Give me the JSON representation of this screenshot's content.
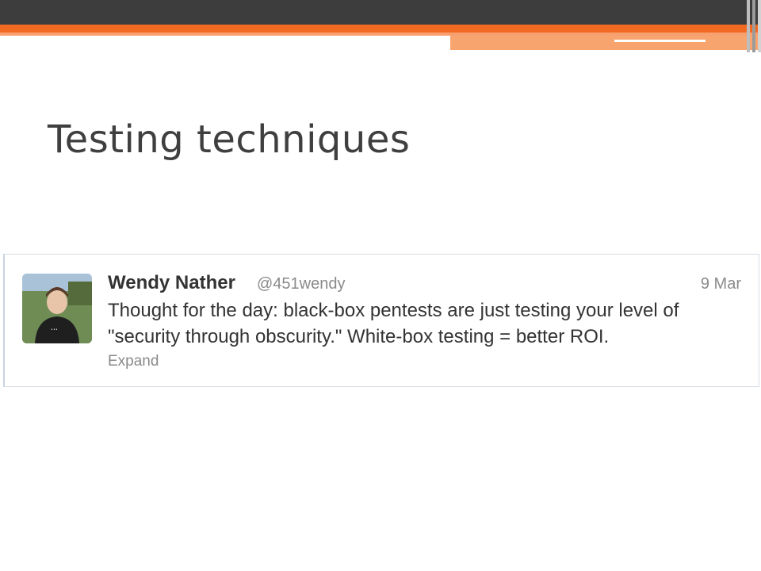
{
  "slide": {
    "title": "Testing techniques"
  },
  "tweet": {
    "author_name": "Wendy Nather",
    "author_handle": "@451wendy",
    "date": "9 Mar",
    "text_line1": "Thought for the day: black-box pentests are just testing your level of",
    "text_line2": "\"security through obscurity.\" White-box testing = better ROI.",
    "expand_label": "Expand"
  },
  "theme": {
    "accent_orange": "#f26a21",
    "header_dark": "#3d3d3d"
  }
}
